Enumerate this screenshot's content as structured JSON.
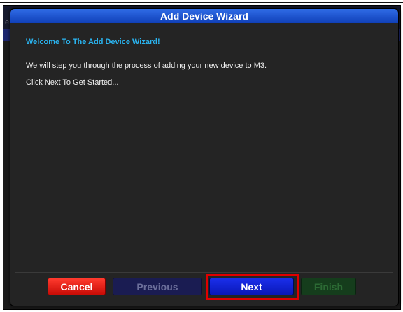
{
  "background": {
    "partial_text": "e"
  },
  "dialog": {
    "title": "Add Device Wizard",
    "welcome_heading": "Welcome To The Add Device Wizard!",
    "intro_text": "We will step you through the process of adding your new device to M3.",
    "start_text": "Click Next To Get Started..."
  },
  "buttons": {
    "cancel": "Cancel",
    "previous": "Previous",
    "next": "Next",
    "finish": "Finish"
  },
  "colors": {
    "title_bar": "#1a52d4",
    "welcome_heading": "#2ab4f0",
    "cancel": "#e0201a",
    "next": "#1226d6",
    "highlight": "#e00000"
  }
}
